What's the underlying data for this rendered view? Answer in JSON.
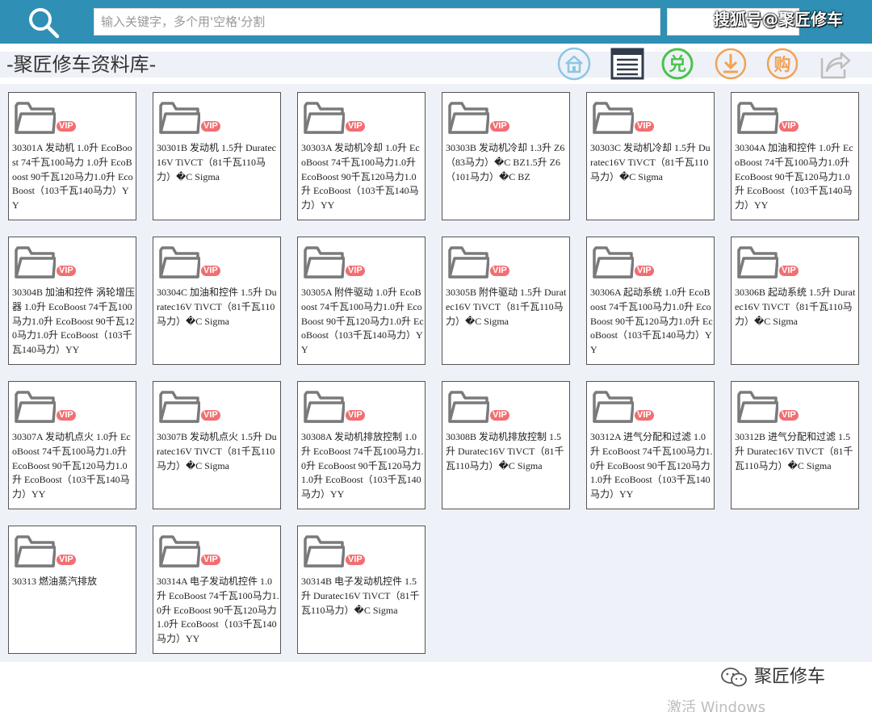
{
  "header": {
    "search_placeholder": "输入关键字，多个用'空格'分割",
    "brand_watermark": "搜狐号@聚匠修车"
  },
  "title": "-聚匠修车资料库-",
  "toolbar": {
    "icons": [
      "home-icon",
      "list-icon",
      "redeem-icon",
      "download-icon",
      "buy-icon",
      "share-icon"
    ],
    "redeem_char": "兑",
    "buy_char": "购"
  },
  "vip_label": "VIP",
  "items": [
    "30301A 发动机 1.0升 EcoBoost 74千瓦100马力 1.0升 EcoBoost 90千瓦120马力1.0升 EcoBoost（103千瓦140马力）YY",
    "30301B 发动机 1.5升 Duratec16V TiVCT（81千瓦110马力）�C Sigma",
    "30303A 发动机冷却 1.0升 EcoBoost 74千瓦100马力1.0升 EcoBoost 90千瓦120马力1.0升 EcoBoost（103千瓦140马力）YY",
    "30303B 发动机冷却 1.3升 Z6（83马力）�C BZ1.5升 Z6（101马力）�C BZ",
    "30303C 发动机冷却 1.5升 Duratec16V TiVCT（81千瓦110马力）�C Sigma",
    "30304A 加油和控件 1.0升 EcoBoost 74千瓦100马力1.0升 EcoBoost 90千瓦120马力1.0升 EcoBoost（103千瓦140马力）YY",
    "30304B 加油和控件 涡轮增压器 1.0升 EcoBoost 74千瓦100马力1.0升 EcoBoost 90千瓦120马力1.0升 EcoBoost（103千瓦140马力）YY",
    "30304C 加油和控件 1.5升 Duratec16V TiVCT（81千瓦110马力）�C Sigma",
    "30305A 附件驱动 1.0升 EcoBoost 74千瓦100马力1.0升 EcoBoost 90千瓦120马力1.0升 EcoBoost（103千瓦140马力）YY",
    "30305B 附件驱动 1.5升 Duratec16V TiVCT（81千瓦110马力）�C Sigma",
    "30306A 起动系统 1.0升 EcoBoost 74千瓦100马力1.0升 EcoBoost 90千瓦120马力1.0升 EcoBoost（103千瓦140马力）YY",
    "30306B 起动系统 1.5升 Duratec16V TiVCT（81千瓦110马力）�C Sigma",
    "30307A 发动机点火 1.0升 EcoBoost 74千瓦100马力1.0升 EcoBoost 90千瓦120马力1.0升 EcoBoost（103千瓦140马力）YY",
    "30307B 发动机点火 1.5升 Duratec16V TiVCT（81千瓦110马力）�C Sigma",
    "30308A 发动机排放控制 1.0升 EcoBoost 74千瓦100马力1.0升 EcoBoost 90千瓦120马力1.0升 EcoBoost（103千瓦140马力）YY",
    "30308B 发动机排放控制 1.5升 Duratec16V TiVCT（81千瓦110马力）�C Sigma",
    "30312A 进气分配和过滤 1.0升 EcoBoost 74千瓦100马力1.0升 EcoBoost 90千瓦120马力1.0升 EcoBoost（103千瓦140马力）YY",
    "30312B 进气分配和过滤 1.5升 Duratec16V TiVCT（81千瓦110马力）�C Sigma",
    "30313 燃油蒸汽排放",
    "30314A 电子发动机控件 1.0升 EcoBoost 74千瓦100马力1.0升 EcoBoost 90千瓦120马力1.0升 EcoBoost（103千瓦140马力）YY",
    "30314B 电子发动机控件 1.5升 Duratec16V TiVCT（81千瓦110马力）�C Sigma"
  ],
  "footer": {
    "brand": "聚匠修车",
    "activate_text": "激活 Windows"
  },
  "colors": {
    "topbar": "#2f8fb5",
    "vip": "#f26e72",
    "home_icon": "#8cc6e6",
    "list_icon": "#2f3a4a",
    "redeem_icon": "#49c34a",
    "download_icon": "#f1a255",
    "buy_icon": "#f1a255",
    "share_icon": "#bdbdbd"
  }
}
